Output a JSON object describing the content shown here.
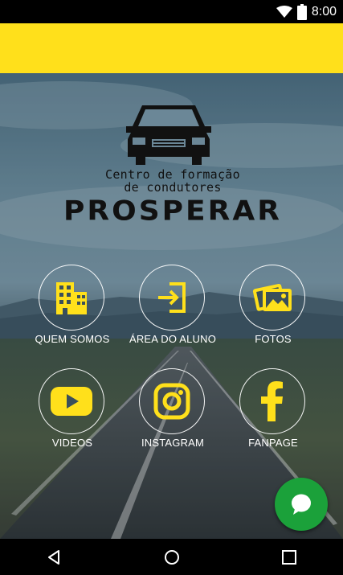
{
  "status_bar": {
    "time": "8:00",
    "icons": [
      "wifi-icon",
      "battery-icon"
    ]
  },
  "app_bar": {
    "color": "#FFE01B"
  },
  "logo": {
    "tagline_line1": "Centro de formação",
    "tagline_line2": "de condutores",
    "brand": "PROSPERAR"
  },
  "menu": {
    "quem_somos": {
      "label": "QUEM SOMOS",
      "icon": "building-icon"
    },
    "area_aluno": {
      "label": "ÁREA DO ALUNO",
      "icon": "login-icon"
    },
    "fotos": {
      "label": "FOTOS",
      "icon": "photos-icon"
    },
    "videos": {
      "label": "VIDEOS",
      "icon": "youtube-icon"
    },
    "instagram": {
      "label": "INSTAGRAM",
      "icon": "instagram-icon"
    },
    "fanpage": {
      "label": "FANPAGE",
      "icon": "facebook-icon"
    }
  },
  "colors": {
    "accent": "#FFE01B",
    "fab": "#1BA13A"
  },
  "fab": {
    "icon": "chat-icon"
  },
  "nav_bar": {
    "buttons": [
      "back-icon",
      "home-icon",
      "recents-icon"
    ]
  }
}
